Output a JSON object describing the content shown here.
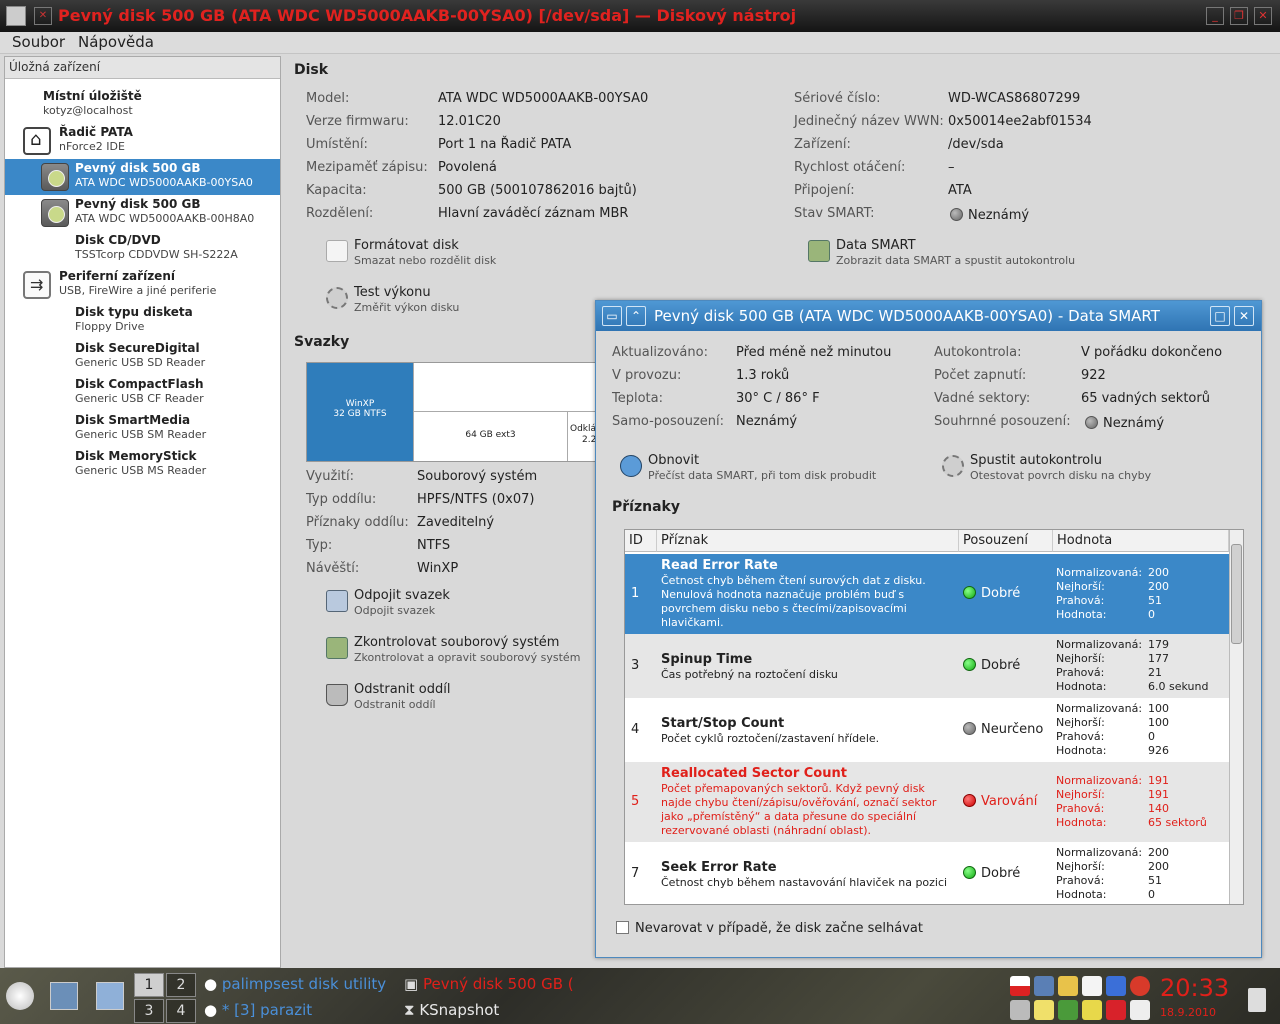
{
  "window": {
    "title": "Pevný disk 500 GB (ATA WDC WD5000AAKB-00YSA0) [/dev/sda] — Diskový nástroj"
  },
  "menubar": {
    "items": [
      "Soubor",
      "Nápověda"
    ]
  },
  "sidebar": {
    "header": "Úložná zařízení",
    "items": [
      {
        "title": "Místní úložiště",
        "subtitle": "kotyz@localhost",
        "icon": "none"
      },
      {
        "title": "Řadič PATA",
        "subtitle": "nForce2 IDE",
        "icon": "pata-controller-icon"
      },
      {
        "title": "Pevný disk 500 GB",
        "subtitle": "ATA WDC WD5000AAKB-00YSA0",
        "icon": "hard-disk-icon",
        "selected": true
      },
      {
        "title": "Pevný disk 500 GB",
        "subtitle": "ATA WDC WD5000AAKB-00H8A0",
        "icon": "hard-disk-icon"
      },
      {
        "title": "Disk CD/DVD",
        "subtitle": "TSSTcorp CDDVDW SH-S222A",
        "icon": "none"
      },
      {
        "title": "Periferní zařízení",
        "subtitle": "USB, FireWire a jiné periferie",
        "icon": "usb-icon"
      },
      {
        "title": "Disk typu disketa",
        "subtitle": "Floppy Drive",
        "icon": "none"
      },
      {
        "title": "Disk SecureDigital",
        "subtitle": "Generic USB SD Reader",
        "icon": "none"
      },
      {
        "title": "Disk CompactFlash",
        "subtitle": "Generic USB CF Reader",
        "icon": "none"
      },
      {
        "title": "Disk SmartMedia",
        "subtitle": "Generic USB SM Reader",
        "icon": "none"
      },
      {
        "title": "Disk MemoryStick",
        "subtitle": "Generic USB MS Reader",
        "icon": "none"
      }
    ]
  },
  "disk": {
    "section_title": "Disk",
    "left": [
      {
        "label": "Model:",
        "value": "ATA WDC WD5000AAKB-00YSA0"
      },
      {
        "label": "Verze firmwaru:",
        "value": "12.01C20"
      },
      {
        "label": "Umístění:",
        "value": "Port 1 na Řadič PATA"
      },
      {
        "label": "Mezipaměť zápisu:",
        "value": "Povolená"
      },
      {
        "label": "Kapacita:",
        "value": "500 GB (500107862016 bajtů)"
      },
      {
        "label": "Rozdělení:",
        "value": "Hlavní zaváděcí záznam MBR"
      }
    ],
    "right": [
      {
        "label": "Sériové číslo:",
        "value": "WD-WCAS86807299"
      },
      {
        "label": "Jedinečný název WWN:",
        "value": "0x50014ee2abf01534"
      },
      {
        "label": "Zařízení:",
        "value": "/dev/sda"
      },
      {
        "label": "Rychlost otáčení:",
        "value": "–"
      },
      {
        "label": "Připojení:",
        "value": "ATA"
      },
      {
        "label": "Stav SMART:",
        "value": "Neznámý"
      }
    ],
    "actions": [
      {
        "title": "Formátovat disk",
        "subtitle": "Smazat nebo rozdělit disk"
      },
      {
        "title": "Data SMART",
        "subtitle": "Zobrazit data SMART a spustit autokontrolu"
      },
      {
        "title": "Test výkonu",
        "subtitle": "Změřit výkon disku"
      }
    ]
  },
  "volumes": {
    "section_title": "Svazky",
    "blocks": {
      "winxp_name": "WinXP",
      "winxp_size": "32 GB NTFS",
      "ext3": "64 GB ext3",
      "odkl_1": "Odklá",
      "odkl_2": "2.2"
    },
    "props": [
      {
        "label": "Využití:",
        "value": "Souborový systém"
      },
      {
        "label": "Typ oddílu:",
        "value": "HPFS/NTFS (0x07)"
      },
      {
        "label": "Příznaky oddílu:",
        "value": "Zaveditelný"
      },
      {
        "label": "Typ:",
        "value": "NTFS"
      },
      {
        "label": "Návěští:",
        "value": "WinXP"
      }
    ],
    "actions": [
      {
        "title": "Odpojit svazek",
        "subtitle": "Odpojit svazek"
      },
      {
        "title": "Zkontrolovat souborový systém",
        "subtitle": "Zkontrolovat a opravit souborový systém"
      },
      {
        "title": "Odstranit oddíl",
        "subtitle": "Odstranit oddíl"
      }
    ]
  },
  "smart_dialog": {
    "title": "Pevný disk 500 GB (ATA WDC WD5000AAKB-00YSA0) - Data SMART",
    "left": [
      {
        "label": "Aktualizováno:",
        "value": "Před méně než minutou"
      },
      {
        "label": "V provozu:",
        "value": "1.3 roků"
      },
      {
        "label": "Teplota:",
        "value": "30° C / 86° F"
      },
      {
        "label": "Samo-posouzení:",
        "value": "Neznámý"
      }
    ],
    "right": [
      {
        "label": "Autokontrola:",
        "value": "V pořádku dokončeno"
      },
      {
        "label": "Počet zapnutí:",
        "value": "922"
      },
      {
        "label": "Vadné sektory:",
        "value": "65 vadných sektorů"
      },
      {
        "label": "Souhrnné posouzení:",
        "value": "Neznámý"
      }
    ],
    "actions": [
      {
        "title": "Obnovit",
        "subtitle": "Přečíst data SMART, při tom disk probudit"
      },
      {
        "title": "Spustit autokontrolu",
        "subtitle": "Otestovat povrch disku na chyby"
      }
    ],
    "attributes_title": "Příznaky",
    "columns": [
      "ID",
      "Příznak",
      "Posouzení",
      "Hodnota"
    ],
    "value_labels": [
      "Normalizovaná:",
      "Nejhorší:",
      "Prahová:",
      "Hodnota:"
    ],
    "rows": [
      {
        "id": "1",
        "name": "Read Error Rate",
        "desc": "Četnost chyb během čtení surových dat z disku. Nenulová hodnota naznačuje problém buď s povrchem disku nebo s čtecími/zapisovacími hlavičkami.",
        "assessment": "Dobré",
        "status": "good",
        "normalized": "200",
        "worst": "200",
        "threshold": "51",
        "value": "0"
      },
      {
        "id": "3",
        "name": "Spinup Time",
        "desc": "Čas potřebný na roztočení disku",
        "assessment": "Dobré",
        "status": "good",
        "normalized": "179",
        "worst": "177",
        "threshold": "21",
        "value": "6.0 sekund"
      },
      {
        "id": "4",
        "name": "Start/Stop Count",
        "desc": "Počet cyklů roztočení/zastavení hřídele.",
        "assessment": "Neurčeno",
        "status": "unknown",
        "normalized": "100",
        "worst": "100",
        "threshold": "0",
        "value": "926"
      },
      {
        "id": "5",
        "name": "Reallocated Sector Count",
        "desc": "Počet přemapovaných sektorů. Když pevný disk najde chybu čtení/zápisu/ověřování, označí sektor jako „přemístěný“ a data přesune do speciální rezervované oblasti (náhradní oblast).",
        "assessment": "Varování",
        "status": "warning",
        "normalized": "191",
        "worst": "191",
        "threshold": "140",
        "value": "65 sektorů"
      },
      {
        "id": "7",
        "name": "Seek Error Rate",
        "desc": "Četnost chyb během nastavování hlaviček na pozici",
        "assessment": "Dobré",
        "status": "good",
        "normalized": "200",
        "worst": "200",
        "threshold": "51",
        "value": "0"
      }
    ],
    "checkbox_label": "Nevarovat v případě, že disk začne selhávat"
  },
  "taskbar": {
    "pager": [
      "1",
      "2",
      "3",
      "4"
    ],
    "tasks": [
      "palimpsest disk utility",
      "* [3] parazit",
      "Pevný disk 500 GB (",
      "KSnapshot"
    ],
    "clock_time": "20:33",
    "clock_date": "18.9.2010",
    "colors": {
      "task_active": "#e0201a",
      "task_inactive": "#4a8fd8",
      "task_normal": "#e8e8e8",
      "clock": "#e0201a"
    }
  }
}
